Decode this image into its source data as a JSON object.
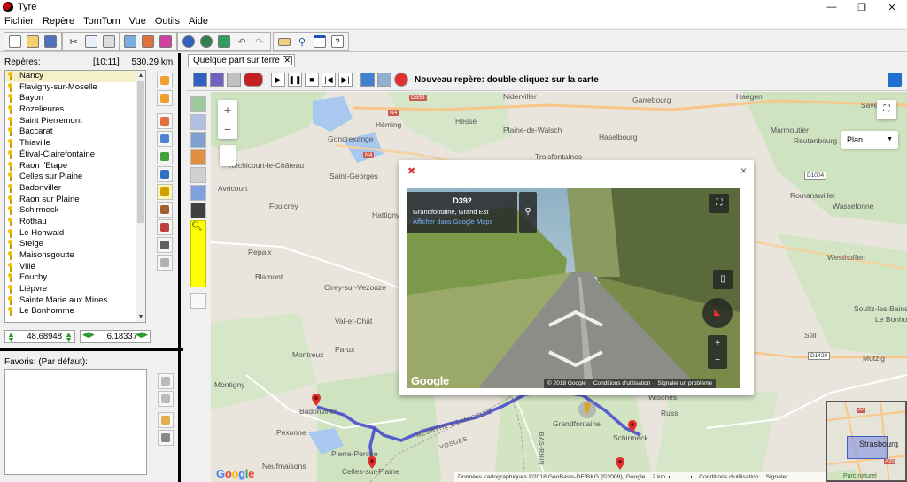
{
  "window": {
    "title": "Tyre",
    "controls": {
      "minimize": "—",
      "maximize": "❐",
      "close": "✕"
    }
  },
  "menu": [
    "Fichier",
    "Repère",
    "TomTom",
    "Vue",
    "Outils",
    "Aide"
  ],
  "reperes": {
    "header_label": "Repères:",
    "time": "[10:11]",
    "distance": "530.29 km.",
    "items": [
      "Nancy",
      "Flavigny-sur-Moselle",
      "Bayon",
      "Rozelieures",
      "Saint Pierremont",
      "Baccarat",
      "Thiaville",
      "Étival-Clairefontaine",
      "Raon l'Etape",
      "Celles sur Plaine",
      "Badonviller",
      "Raon sur Plaine",
      "Schirmeck",
      "Rothau",
      "Le Hohwald",
      "Steige",
      "Maisonsgoutte",
      "Villé",
      "Fouchy",
      "Liépvre",
      "Sainte Marie aux Mines",
      "Le Bonhomme"
    ],
    "selected_index": 0,
    "latitude": "48.68948",
    "longitude": "6.18337"
  },
  "favoris": {
    "header_label": "Favoris: (Par défaut):"
  },
  "map_tab": {
    "label": "Quelque part sur terre",
    "close": "✕"
  },
  "map_toolbar": {
    "new_marker_hint": "Nouveau repère: double-cliquez sur la carte"
  },
  "map": {
    "zoom_in": "+",
    "zoom_out": "−",
    "fullscreen": "⛶",
    "map_type": "Plan",
    "map_type_caret": "▼",
    "places": [
      {
        "name": "Niderviller",
        "key": "p1"
      },
      {
        "name": "Garrebourg",
        "key": "p2"
      },
      {
        "name": "Haegen",
        "key": "p3"
      },
      {
        "name": "Saverne",
        "key": "p4"
      },
      {
        "name": "Héming",
        "key": "p5"
      },
      {
        "name": "Hesse",
        "key": "p6"
      },
      {
        "name": "Plaine-de-Walsch",
        "key": "p7"
      },
      {
        "name": "Haselbourg",
        "key": "p8"
      },
      {
        "name": "Marmoutier",
        "key": "p9"
      },
      {
        "name": "Reutenbourg",
        "key": "p10"
      },
      {
        "name": "Gondrexange",
        "key": "p11"
      },
      {
        "name": "Troisfontaines",
        "key": "p12"
      },
      {
        "name": "Réchicourt-le-Château",
        "key": "p13"
      },
      {
        "name": "Saint-Georges",
        "key": "p14"
      },
      {
        "name": "Avricourt",
        "key": "p15"
      },
      {
        "name": "Foulcrey",
        "key": "p16"
      },
      {
        "name": "Hattigny",
        "key": "p17"
      },
      {
        "name": "Romanswiller",
        "key": "p18"
      },
      {
        "name": "Wasselonne",
        "key": "p19"
      },
      {
        "name": "Repaix",
        "key": "p20"
      },
      {
        "name": "Blamont",
        "key": "p21"
      },
      {
        "name": "Cirey-sur-Vezouze",
        "key": "p22"
      },
      {
        "name": "Westhoffen",
        "key": "p23"
      },
      {
        "name": "Val-et-Chât",
        "key": "p24"
      },
      {
        "name": "Soultz-les-Bains",
        "key": "p25"
      },
      {
        "name": "Le Bonhomme",
        "key": "p25b"
      },
      {
        "name": "Parux",
        "key": "p26"
      },
      {
        "name": "Montreux",
        "key": "p27"
      },
      {
        "name": "Still",
        "key": "p28"
      },
      {
        "name": "Mutzig",
        "key": "p29"
      },
      {
        "name": "Montigny",
        "key": "p30"
      },
      {
        "name": "Badonviller",
        "key": "p31"
      },
      {
        "name": "Wisches",
        "key": "p32"
      },
      {
        "name": "Russ",
        "key": "p33"
      },
      {
        "name": "Pexonne",
        "key": "p34"
      },
      {
        "name": "Grandfontaine",
        "key": "p35"
      },
      {
        "name": "Schirmeck",
        "key": "p36"
      },
      {
        "name": "Pierre-Percée",
        "key": "p37"
      },
      {
        "name": "Celles-sur-Plaine",
        "key": "p38"
      },
      {
        "name": "Neufmaisons",
        "key": "p39"
      },
      {
        "name": "MEURTHE-ET-MOSELLE",
        "key": "p40"
      },
      {
        "name": "VOSGES",
        "key": "p41"
      },
      {
        "name": "BAS-RHIN",
        "key": "p42"
      }
    ],
    "roads": [
      "D955",
      "N4",
      "N4",
      "D1004",
      "D1420",
      "D392"
    ],
    "google_logo": "Google",
    "footer": {
      "data": "Données cartographiques ©2018 GeoBasis-DE/BKG (©2009), Google",
      "scale": "2 km",
      "terms": "Conditions d'utilisation",
      "report": "Signaler"
    },
    "mini_map": {
      "label": "Strasbourg",
      "road_top": "A4",
      "road_bottom": "A35",
      "partial": "Parc naturel"
    }
  },
  "streetview": {
    "road": "D392",
    "place": "Grandfontaine, Grand Est",
    "link": "Afficher dans Google Maps",
    "google_logo": "Google",
    "copyright": "© 2018 Google",
    "terms": "Conditions d'utilisation",
    "report": "Signaler un problème",
    "close": "×",
    "zoom_in": "+",
    "zoom_out": "−"
  },
  "colors": {
    "route": "#3f45d0",
    "marker": "#e03030",
    "selection": "#f5f0c8",
    "highlight_yellow": "#ffff00"
  }
}
